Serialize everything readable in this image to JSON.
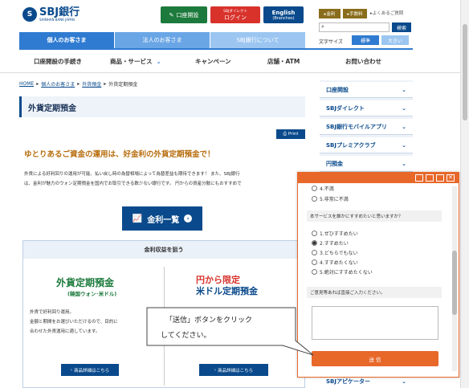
{
  "header": {
    "logo_mark": "S",
    "logo_text": "SBJ銀行",
    "logo_sub": "SHINHAN BANK JAPAN",
    "account_open": "口座開設",
    "direct_top": "SBJダイレクト",
    "direct_login": "ログイン",
    "english": "English",
    "english_sub": "(Branches)",
    "rate": "▸金利",
    "fee": "▸手数料",
    "faq": "▸よくあるご質問",
    "search_btn": "検索",
    "text_size_label": "文字サイズ",
    "size_normal": "標準",
    "size_large": "大きい"
  },
  "tabs": [
    "個人のお客さま",
    "法人のお客さま",
    "SBJ銀行について"
  ],
  "nav": [
    "口座開設の手続き",
    "商品・サービス",
    "キャンペーン",
    "店舗・ATM",
    "お問い合わせ"
  ],
  "breadcrumb": [
    "HOME",
    "個人のお客さま",
    "外貨預金",
    "外貨定期預金"
  ],
  "page_title": "外貨定期預金",
  "print_label": "Print",
  "headline": "ゆとりあるご資金の運用は、好金利の外貨定期預金で！",
  "body_line1": "外貨による好利回りの運用が可能、払い戻し時の為替相場によって為替差益も期待できます！ また、SBJ銀行",
  "body_line2": "は、金利が魅力のウォン定期預金を国内でお取引できる数少ない銀行です。 円からの資産分散にもおすすめで",
  "rate_button": "金利一覧",
  "section_title": "金利収益を狙う",
  "product1_title": "外貨定期預金",
  "product1_sub": "(韓国ウォン･米ドル)",
  "product1_desc1": "外貨で好利回り運用。",
  "product1_desc2": "金額と期間をお選びいただけるので、目的に",
  "product1_desc3": "合わせた外貨運用に適しています。",
  "product1_btn": "商品詳細はこちら",
  "product2_title1": "円から限定",
  "product2_title2": "米ドル定期預金",
  "product2_btn": "商品詳細はこちら",
  "sidebar": [
    "口座開設",
    "SBJダイレクト",
    "SBJ銀行モバイルアプリ",
    "SBJプレミアクラブ",
    "円預金",
    "SBJアピケーター"
  ],
  "survey": {
    "top_options": [
      "4.不満",
      "5.非常に不満"
    ],
    "question": "本サービスを誰かにすすめたいと思いますか？",
    "options": [
      "1.ぜひすすめたい",
      "2.すすめたい",
      "3.どちらでもない",
      "4.すすめたくない",
      "5.絶対にすすめたくない"
    ],
    "selected_index": 1,
    "comment_label": "ご意見等あれば直接ご入力ください。",
    "submit": "送 信"
  },
  "callout_line1": "「送信」ボタンをクリック",
  "callout_line2": "してください。",
  "colors": {
    "brand": "#0a4a8c",
    "tab_blue": "#2f7bd1",
    "orange": "#e8682a",
    "green": "#1c7a3c",
    "red": "#d8322b"
  }
}
